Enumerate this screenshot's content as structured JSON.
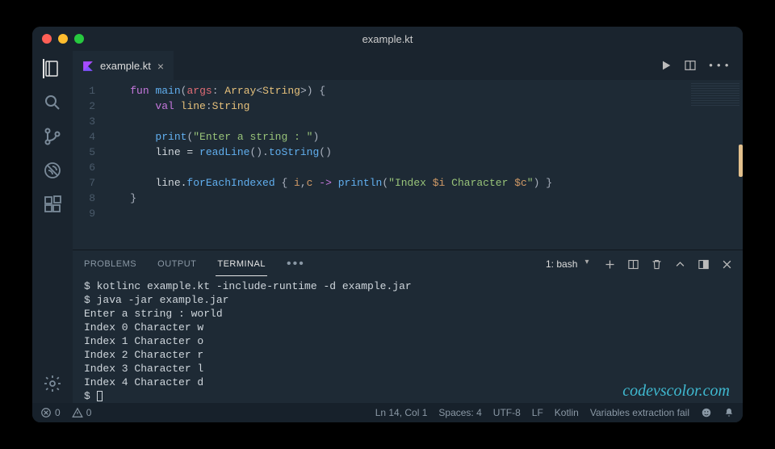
{
  "window_title": "example.kt",
  "tab": {
    "label": "example.kt",
    "icon": "kotlin-icon"
  },
  "editor": {
    "line_numbers": [
      "1",
      "2",
      "3",
      "4",
      "5",
      "6",
      "7",
      "8",
      "9"
    ],
    "lines": [
      [
        {
          "t": "    "
        },
        {
          "t": "fun ",
          "c": "kw"
        },
        {
          "t": "main",
          "c": "fn"
        },
        {
          "t": "(",
          "c": "pn"
        },
        {
          "t": "args",
          "c": "pa"
        },
        {
          "t": ": ",
          "c": "pn"
        },
        {
          "t": "Array",
          "c": "ty"
        },
        {
          "t": "<",
          "c": "pn"
        },
        {
          "t": "String",
          "c": "ty"
        },
        {
          "t": ">) {",
          "c": "pn"
        }
      ],
      [
        {
          "t": "        "
        },
        {
          "t": "val ",
          "c": "kw"
        },
        {
          "t": "line",
          "c": "id"
        },
        {
          "t": ":",
          "c": "pn"
        },
        {
          "t": "String",
          "c": "ty"
        }
      ],
      [
        {
          "t": " "
        }
      ],
      [
        {
          "t": "        "
        },
        {
          "t": "print",
          "c": "fn"
        },
        {
          "t": "(",
          "c": "pn"
        },
        {
          "t": "\"Enter a string : \"",
          "c": "st"
        },
        {
          "t": ")",
          "c": "pn"
        }
      ],
      [
        {
          "t": "        line = "
        },
        {
          "t": "readLine",
          "c": "fn"
        },
        {
          "t": "().",
          "c": "pn"
        },
        {
          "t": "toString",
          "c": "fn"
        },
        {
          "t": "()",
          "c": "pn"
        }
      ],
      [
        {
          "t": " "
        }
      ],
      [
        {
          "t": "        line."
        },
        {
          "t": "forEachIndexed",
          "c": "fn"
        },
        {
          "t": " { ",
          "c": "pn"
        },
        {
          "t": "i",
          "c": "va"
        },
        {
          "t": ",",
          "c": "pn"
        },
        {
          "t": "c",
          "c": "va"
        },
        {
          "t": " ",
          "c": "pn"
        },
        {
          "t": "->",
          "c": "op"
        },
        {
          "t": " ",
          "c": "pn"
        },
        {
          "t": "println",
          "c": "fn"
        },
        {
          "t": "(",
          "c": "pn"
        },
        {
          "t": "\"Index ",
          "c": "st"
        },
        {
          "t": "$i",
          "c": "va"
        },
        {
          "t": " Character ",
          "c": "st"
        },
        {
          "t": "$c",
          "c": "va"
        },
        {
          "t": "\"",
          "c": "st"
        },
        {
          "t": ") }",
          "c": "pn"
        }
      ],
      [
        {
          "t": "    }",
          "c": "pn"
        }
      ],
      [
        {
          "t": " "
        }
      ]
    ]
  },
  "panel": {
    "tabs": {
      "problems": "PROBLEMS",
      "output": "OUTPUT",
      "terminal": "TERMINAL"
    },
    "select_value": "1: bash",
    "terminal_lines": [
      "$ kotlinc example.kt -include-runtime -d example.jar",
      "$ java -jar example.jar",
      "Enter a string : world",
      "Index 0 Character w",
      "Index 1 Character o",
      "Index 2 Character r",
      "Index 3 Character l",
      "Index 4 Character d",
      "$ "
    ]
  },
  "statusbar": {
    "errors": "0",
    "warnings": "0",
    "position": "Ln 14, Col 1",
    "spaces": "Spaces: 4",
    "encoding": "UTF-8",
    "eol": "LF",
    "language": "Kotlin",
    "message": "Variables extraction fail"
  },
  "watermark": "codevscolor.com"
}
